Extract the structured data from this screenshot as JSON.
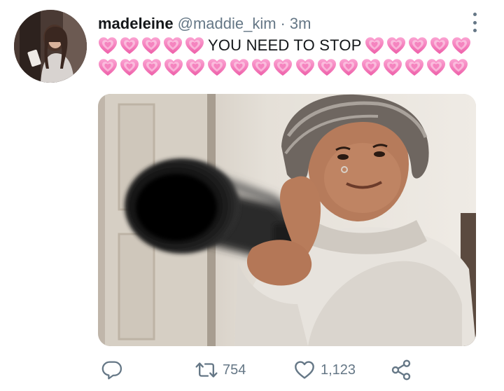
{
  "tweet": {
    "author_name": "madeleine",
    "handle": "@maddie_kim",
    "separator": "·",
    "time": "3m",
    "text": "YOU NEED TO STOP",
    "emoji": "growing-heart",
    "emoji_count_before": 5,
    "emoji_count_after": 5,
    "emoji_count_line2": 17
  },
  "actions": {
    "reply": {
      "icon": "reply-icon",
      "count": ""
    },
    "retweet": {
      "icon": "retweet-icon",
      "count": "754"
    },
    "like": {
      "icon": "heart-outline-icon",
      "count": "1,123"
    },
    "share": {
      "icon": "share-icon"
    }
  },
  "colors": {
    "text": "#14171a",
    "secondary": "#657786",
    "heart_pink": "#f27ab8",
    "background": "#ffffff"
  }
}
